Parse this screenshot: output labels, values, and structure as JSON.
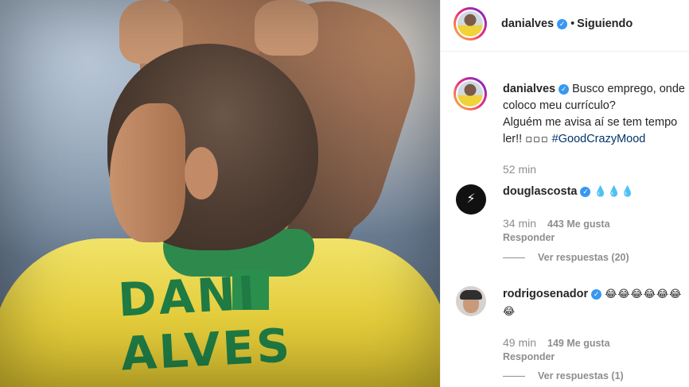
{
  "post": {
    "jersey_text": "DANI ALVES"
  },
  "header": {
    "username": "danialves",
    "verified_icon": "verified-badge-icon",
    "separator": "•",
    "follow_status": "Siguiendo"
  },
  "caption": {
    "username": "danialves",
    "text_line1": "Busco emprego, onde",
    "text_line2": "coloco meu currículo?",
    "text_line3": "Alguém me avisa aí se tem tempo",
    "text_line4": "ler!! ",
    "emojis": "▫▫▫",
    "hashtag": "#GoodCrazyMood",
    "time": "52 min"
  },
  "comments": [
    {
      "username": "douglascosta",
      "text": "💧💧💧",
      "time": "34 min",
      "likes": "443 Me gusta",
      "reply": "Responder",
      "view_replies": "Ver respuestas (20)"
    },
    {
      "username": "rodrigosenador",
      "text": "😂😂😂😂😂😂",
      "text_cont": "😂",
      "time": "49 min",
      "likes": "149 Me gusta",
      "reply": "Responder",
      "view_replies": "Ver respuestas (1)"
    }
  ],
  "colors": {
    "verified": "#3897f0",
    "muted": "#8e8e8e",
    "hashtag": "#003569",
    "text": "#262626"
  }
}
